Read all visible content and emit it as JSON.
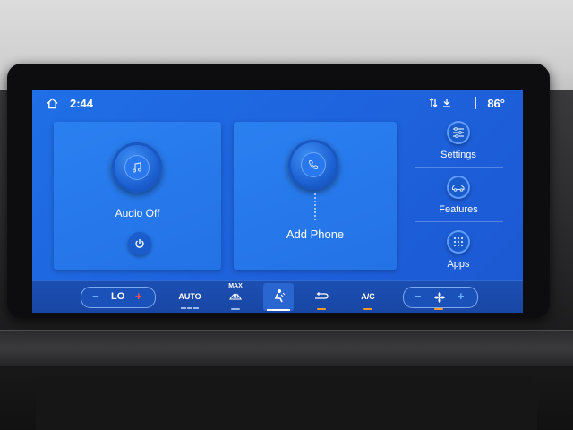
{
  "status": {
    "time": "2:44",
    "temperature": "86°"
  },
  "cards": {
    "audio": {
      "label": "Audio Off"
    },
    "phone": {
      "label": "Add Phone"
    }
  },
  "side_nav": {
    "settings": "Settings",
    "features": "Features",
    "apps": "Apps"
  },
  "climate": {
    "driver_temp_minus": "−",
    "driver_temp": "LO",
    "driver_temp_plus": "+",
    "auto": "AUTO",
    "max_defrost": "MAX",
    "ac": "A/C",
    "fan_minus": "−",
    "fan_plus": "+"
  },
  "colors": {
    "screen": "#1f6fe6",
    "card": "#2b80f0",
    "climate_bar": "#1c4fb3",
    "accent_red": "#ff4a4a",
    "accent_blue": "#6ab0ff",
    "indicator_orange": "#ff9a2a"
  }
}
